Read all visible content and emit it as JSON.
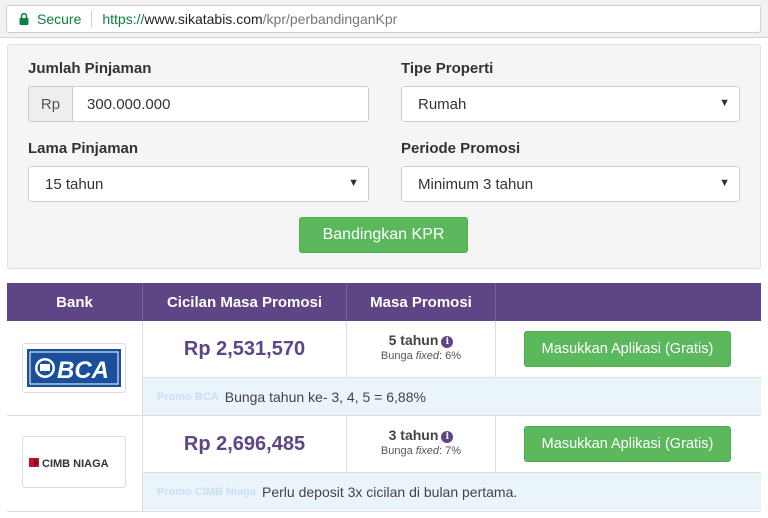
{
  "browser": {
    "secure_label": "Secure",
    "url_protocol": "https://",
    "url_host": "www.sikatabis.com",
    "url_path": "/kpr/perbandinganKpr"
  },
  "form": {
    "loan_amount_label": "Jumlah Pinjaman",
    "currency_addon": "Rp",
    "loan_amount_value": "300.000.000",
    "property_type_label": "Tipe Properti",
    "property_type_value": "Rumah",
    "loan_term_label": "Lama Pinjaman",
    "loan_term_value": "15 tahun",
    "promo_period_label": "Periode Promosi",
    "promo_period_value": "Minimum 3 tahun",
    "compare_button": "Bandingkan KPR"
  },
  "table": {
    "headers": [
      "Bank",
      "Cicilan Masa Promosi",
      "Masa Promosi",
      ""
    ],
    "rows": [
      {
        "bank": "BCA",
        "installment": "Rp 2,531,570",
        "promo_years": "5 tahun",
        "rate_prefix": "Bunga ",
        "rate_fixed": "fixed",
        "rate_suffix": ": 6%",
        "apply_button": "Masukkan Aplikasi (Gratis)",
        "note_tag": "Promo BCA",
        "note": "Bunga tahun ke- 3, 4, 5 = 6,88%"
      },
      {
        "bank": "CIMB NIAGA",
        "installment": "Rp 2,696,485",
        "promo_years": "3 tahun",
        "rate_prefix": "Bunga ",
        "rate_fixed": "fixed",
        "rate_suffix": ": 7%",
        "apply_button": "Masukkan Aplikasi (Gratis)",
        "note_tag": "Promo CIMB Niaga",
        "note": "Perlu deposit 3x cicilan di bulan pertama."
      }
    ]
  },
  "colors": {
    "header_purple": "#5e4585",
    "success_green": "#5cb85c",
    "bca_blue": "#1a4f9c",
    "cimb_red": "#c8102e"
  }
}
